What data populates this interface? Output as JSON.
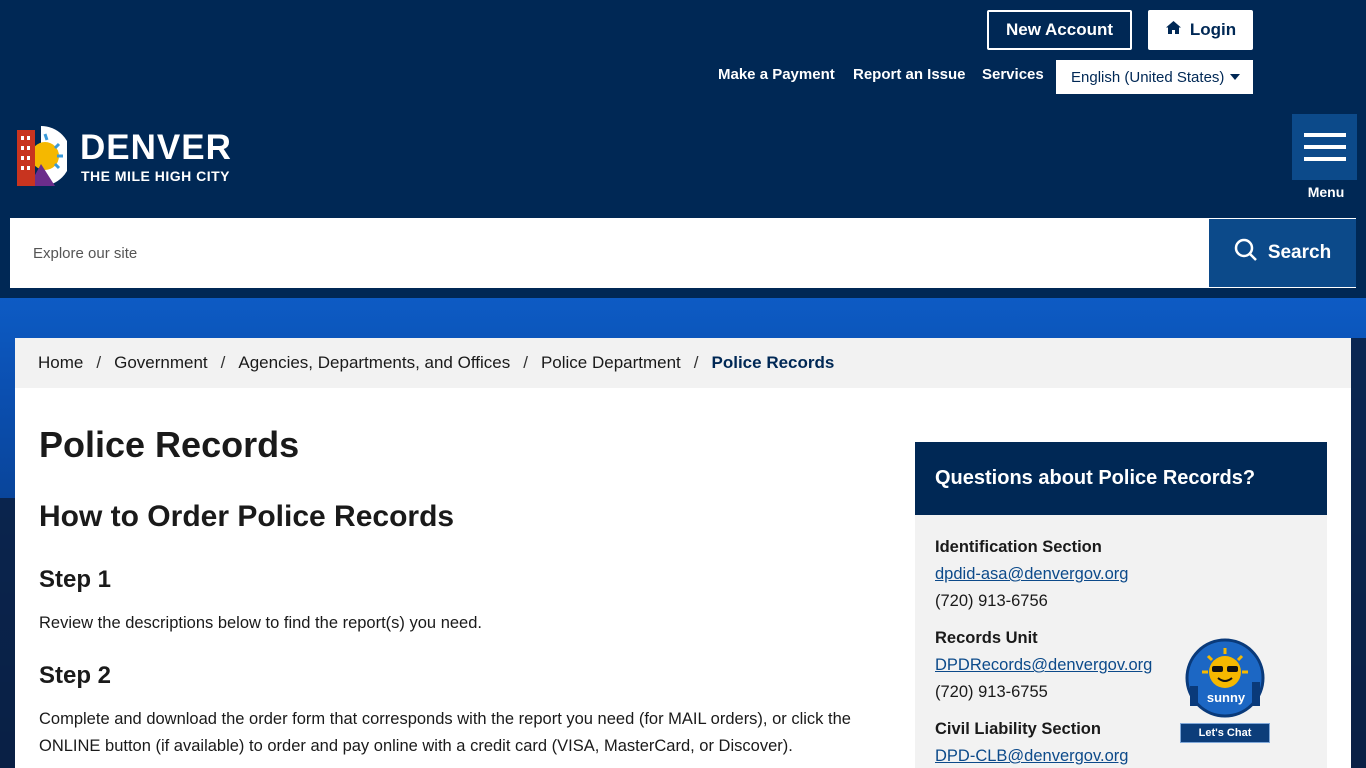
{
  "header": {
    "new_account": "New Account",
    "login": "Login",
    "util_links": [
      "Make a Payment",
      "Report an Issue",
      "Services"
    ],
    "language": "English (United States)",
    "logo_word": "DENVER",
    "logo_tag": "THE MILE HIGH CITY",
    "menu_label": "Menu"
  },
  "search": {
    "placeholder": "Explore our site",
    "button": "Search"
  },
  "breadcrumb": [
    "Home",
    "Government",
    "Agencies, Departments, and Offices",
    "Police Department"
  ],
  "breadcrumb_current": "Police Records",
  "main": {
    "title": "Police Records",
    "subtitle": "How to Order Police Records",
    "step1_title": "Step 1",
    "step1_text": "Review the descriptions below to find the report(s) you need.",
    "step2_title": "Step 2",
    "step2_text": "Complete and download the order form that corresponds with the report you need (for MAIL orders), or click the ONLINE button (if available) to order and pay online with a credit card (VISA, MasterCard, or Discover)."
  },
  "sidebar": {
    "heading": "Questions about Police Records?",
    "contacts": [
      {
        "label": "Identification Section",
        "email": "dpdid-asa@denvergov.org",
        "phone": "(720) 913-6756"
      },
      {
        "label": "Records Unit",
        "email": "DPDRecords@denvergov.org",
        "phone": "(720) 913-6755"
      },
      {
        "label": "Civil Liability Section",
        "email": "DPD-CLB@denvergov.org"
      }
    ]
  },
  "chat": {
    "badge_text": "sunny",
    "button": "Let's Chat"
  },
  "colors": {
    "navy": "#002855",
    "accent_blue": "#0c4a8a",
    "light_gray": "#f2f2f2"
  }
}
